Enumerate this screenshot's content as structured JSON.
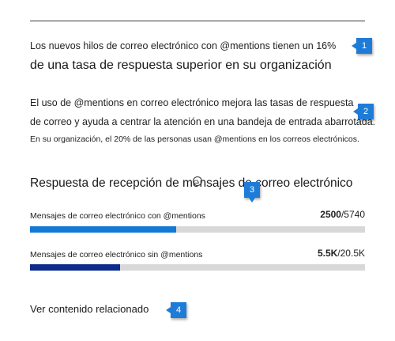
{
  "colors": {
    "accent_with": "#1478d6",
    "accent_without": "#0d2b8c",
    "track": "#d8d8d8",
    "callout": "#1e7cd8"
  },
  "insight": {
    "headline_small": "Los nuevos hilos de correo electrónico con @mentions tienen un 16%",
    "headline_large": "de una tasa de respuesta superior en su organización",
    "para_line1": "El uso de @mentions en correo electrónico mejora las tasas de respuesta",
    "para_line2": "de correo y ayuda a centrar la atención en una bandeja de entrada abarrotada.",
    "para_small": "En su organización, el 20% de las personas usan @mentions en los correos electrónicos."
  },
  "section": {
    "title": "Respuesta de recepción de mensajes de correo electrónico"
  },
  "bars": [
    {
      "label": "Mensajes de correo electrónico con @mentions",
      "value_main": "2500",
      "value_total": "/5740",
      "fraction": 0.436
    },
    {
      "label": "Mensajes de correo electrónico sin @mentions",
      "value_main": "5.5K",
      "value_total": "/20.5K",
      "fraction": 0.268
    }
  ],
  "related_link": "Ver contenido relacionado",
  "callouts": [
    "1",
    "2",
    "3",
    "4"
  ]
}
